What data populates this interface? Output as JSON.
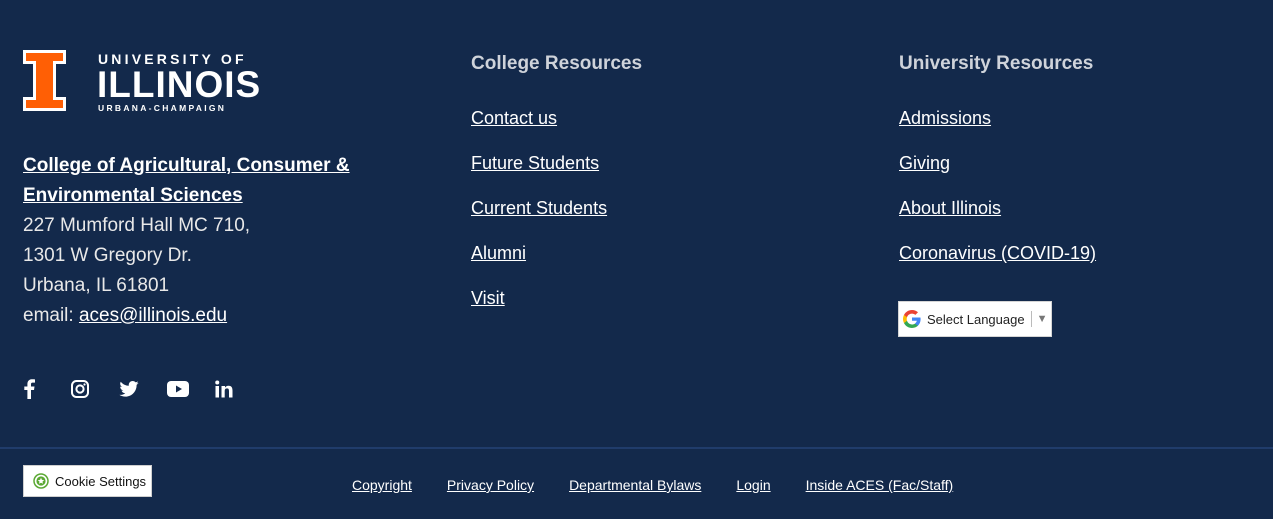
{
  "brand": {
    "logo_top": "UNIVERSITY OF",
    "logo_main": "ILLINOIS",
    "logo_bottom": "URBANA-CHAMPAIGN",
    "accent": "#ff5f05",
    "background": "#13294b"
  },
  "address": {
    "college_line1": "College of Agricultural, Consumer &",
    "college_line2": "Environmental Sciences",
    "street": "227 Mumford Hall MC 710,",
    "street2": "1301 W Gregory Dr.",
    "city": "Urbana, IL 61801",
    "email_label": "email:",
    "email": "aces@illinois.edu"
  },
  "social": [
    "facebook-icon",
    "instagram-icon",
    "twitter-icon",
    "youtube-icon",
    "linkedin-icon"
  ],
  "college_resources": {
    "title": "College Resources",
    "items": [
      "Contact us",
      "Future Students",
      "Current Students",
      "Alumni",
      "Visit"
    ]
  },
  "university_resources": {
    "title": "University Resources",
    "items": [
      "Admissions",
      "Giving",
      "About Illinois",
      "Coronavirus (COVID-19)"
    ]
  },
  "language": {
    "label": "Select Language"
  },
  "cookie": {
    "label": "Cookie Settings"
  },
  "bottom_links": [
    "Copyright",
    "Privacy Policy",
    "Departmental Bylaws",
    "Login",
    "Inside ACES (Fac/Staff)"
  ]
}
